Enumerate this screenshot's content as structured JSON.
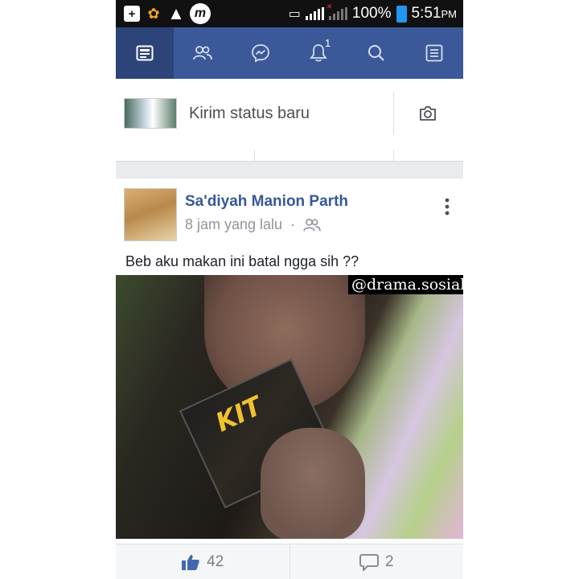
{
  "statusbar": {
    "icons": [
      "add-box-icon",
      "uc-browser-icon",
      "warning-icon",
      "m-app-icon",
      "vibrate-icon",
      "signal-h-icon",
      "signal-no-sim-icon",
      "battery-icon"
    ],
    "battery": "100%",
    "time": "5:51",
    "ampm": "PM"
  },
  "nav": {
    "items": [
      {
        "name": "news-feed",
        "icon": "news-feed-icon",
        "active": true
      },
      {
        "name": "friend-requests",
        "icon": "friends-icon"
      },
      {
        "name": "messenger",
        "icon": "messenger-icon"
      },
      {
        "name": "notifications",
        "icon": "bell-icon",
        "badge": "1"
      },
      {
        "name": "search",
        "icon": "search-icon"
      },
      {
        "name": "menu",
        "icon": "menu-list-icon"
      }
    ]
  },
  "composer": {
    "placeholder": "Kirim status baru",
    "icon": "camera-icon"
  },
  "post": {
    "author": "Sa'diyah Manion Parth",
    "time": "8 jam yang lalu",
    "separator": "·",
    "audience_icon": "friends-audience-icon",
    "text": "Beb aku makan ini batal ngga sih ??",
    "watermark": "@drama.sosialmedia",
    "packet_logo": "KIT",
    "likes": "42",
    "comments": "2"
  },
  "colors": {
    "brand": "#3b5998",
    "brand_active": "#2d4479",
    "link": "#365899",
    "like_blue": "#4267b2"
  }
}
